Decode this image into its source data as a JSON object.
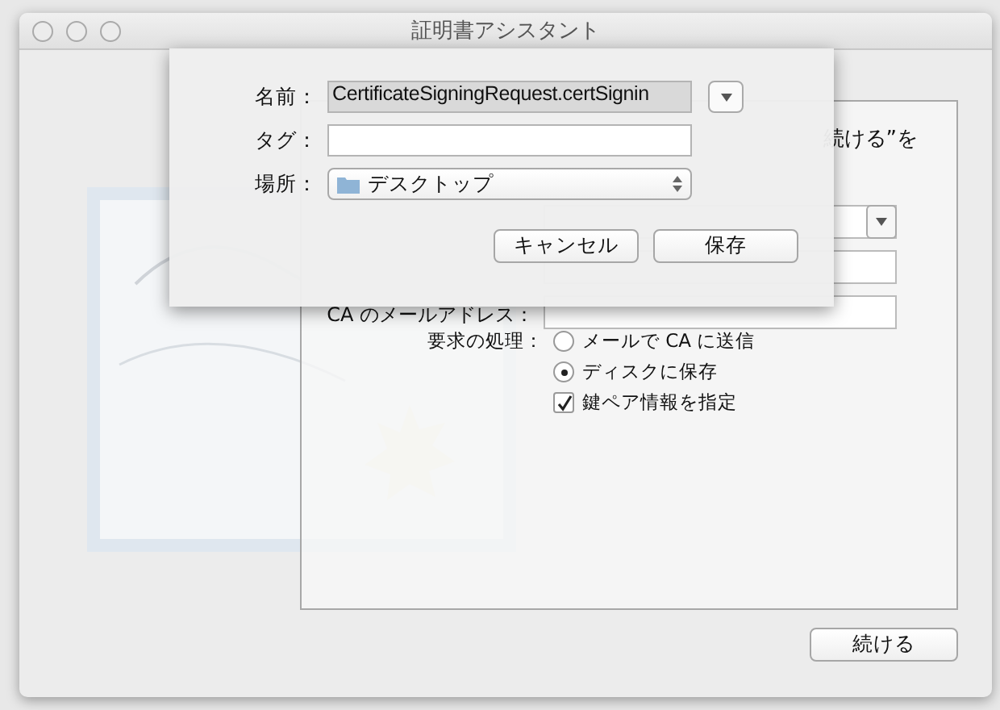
{
  "window": {
    "title": "証明書アシスタント"
  },
  "intro_fragment": "続ける”を",
  "form": {
    "ca_email_label": "CA のメールアドレス：",
    "request_label": "要求の処理：",
    "request_options": [
      {
        "label": "メールで CA に送信",
        "selected": false
      },
      {
        "label": "ディスクに保存",
        "selected": true
      }
    ],
    "key_pair": {
      "label": "鍵ペア情報を指定",
      "checked": true
    }
  },
  "continue_button": "続ける",
  "save_sheet": {
    "name_label": "名前：",
    "name_value": "CertificateSigningRequest.certSignin",
    "tags_label": "タグ：",
    "location_label": "場所：",
    "location_value": "デスクトップ",
    "cancel_button": "キャンセル",
    "save_button": "保存"
  }
}
